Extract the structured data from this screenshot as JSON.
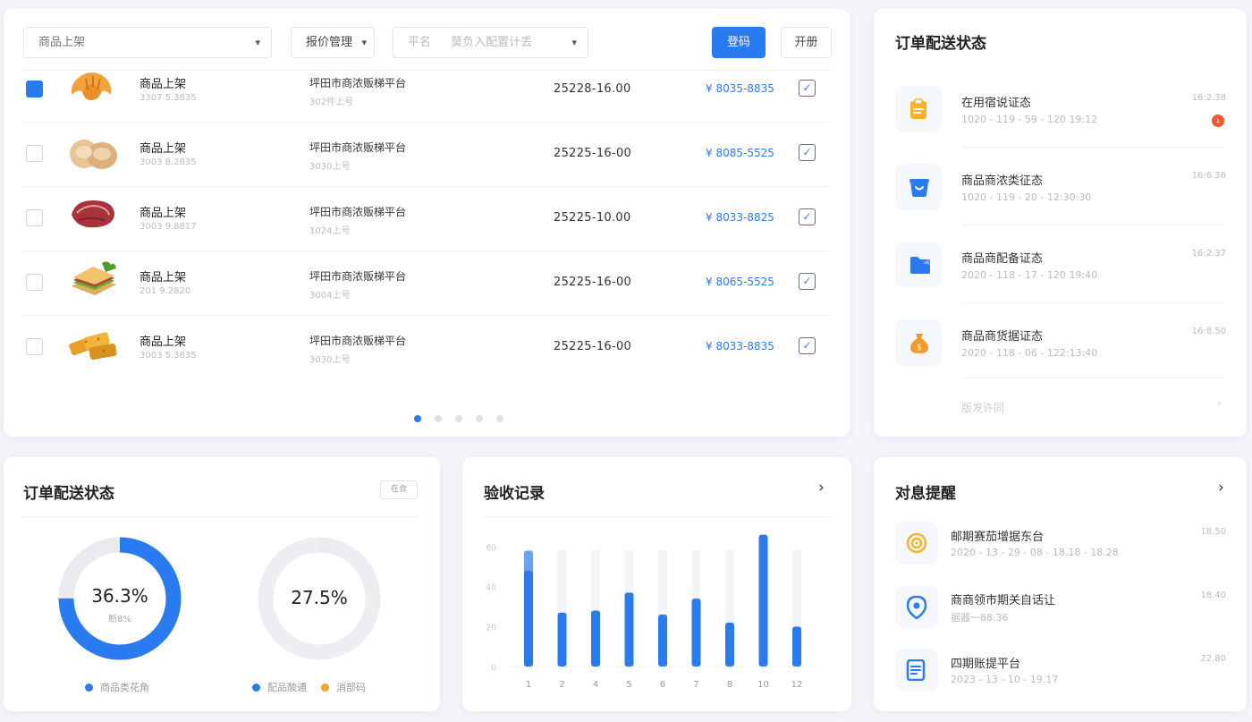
{
  "filters": {
    "category_select": "商品上架",
    "quote_select": "报价管理",
    "name_label": "平名",
    "name_placeholder": "莫负入配置计丢",
    "primary_button": "登码",
    "secondary_button": "开册"
  },
  "products": [
    {
      "name": "商品上架",
      "sub": "3307 5.3835",
      "platform": "坪田市商浓贩梯平台",
      "platform_sub": "302件上号",
      "code": "25228-16.00",
      "price": "¥ 8035-8835",
      "selected": true,
      "icon": "croissant-icon"
    },
    {
      "name": "商品上架",
      "sub": "3003 8.2835",
      "platform": "坪田市商浓贩梯平台",
      "platform_sub": "3030上号",
      "code": "25225-16-00",
      "price": "¥ 8085-5525",
      "selected": false,
      "icon": "bread-icon"
    },
    {
      "name": "商品上架",
      "sub": "3003 9.8817",
      "platform": "坪田市商浓贩梯平台",
      "platform_sub": "1024上号",
      "code": "25225-10.00",
      "price": "¥ 8033-8825",
      "selected": false,
      "icon": "meat-icon"
    },
    {
      "name": "商品上架",
      "sub": "201 9.2820",
      "platform": "坪田市商浓贩梯平台",
      "platform_sub": "3004上号",
      "code": "25225-16-00",
      "price": "¥ 8065-5525",
      "selected": false,
      "icon": "sandwich-icon"
    },
    {
      "name": "商品上架",
      "sub": "3003 5.3835",
      "platform": "坪田市商浓贩梯平台",
      "platform_sub": "3030上号",
      "code": "25225-16-00",
      "price": "¥ 8033-8835",
      "selected": false,
      "icon": "fried-tofu-icon"
    }
  ],
  "pagination": {
    "pages": 5,
    "current": 1
  },
  "delivery": {
    "title": "订单配送状态",
    "items": [
      {
        "name": "在用宿说证态",
        "time": "1020 - 119 - 59 - 120 19:12",
        "clock": "16:2.38",
        "badge": "1",
        "icon": "clipboard-icon",
        "icon_color": "#f7b228"
      },
      {
        "name": "商品商浓类征态",
        "time": "1020 - 119 - 20 - 12:30:30",
        "clock": "16:6.36",
        "icon": "basket-icon",
        "icon_color": "#2b7bf0"
      },
      {
        "name": "商品商配备证态",
        "time": "2020 - 118 - 17 - 120 19:40",
        "clock": "16:2.37",
        "icon": "folder-icon",
        "icon_color": "#2b7bf0"
      },
      {
        "name": "商品商货据证态",
        "time": "2020 - 118 - 06 - 122:13:40",
        "clock": "16:8.50",
        "icon": "money-bag-icon",
        "icon_color": "#f39a2b"
      }
    ],
    "more_label": "版发许同"
  },
  "donut_card": {
    "title": "订单配送状态",
    "tag": "在合",
    "donut1": {
      "percent_label": "36.3%",
      "sub": "断8%",
      "value": 0.75,
      "color": "#2b7bf0"
    },
    "donut2": {
      "percent_label": "27.5%",
      "value": 0.03,
      "color": "#e9ebef"
    },
    "legend1": {
      "label": "商品类花角",
      "color": "#2b7bf0"
    },
    "legend2a": {
      "label": "配品酸通",
      "color": "#2b7bf0"
    },
    "legend2b": {
      "label": "消部码",
      "color": "#f3a129"
    }
  },
  "bar_card": {
    "title": "验收记录"
  },
  "chart_data": {
    "type": "bar",
    "title": "验收记录",
    "categories": [
      "1",
      "2",
      "4",
      "5",
      "6",
      "7",
      "8",
      "10",
      "12"
    ],
    "series": [
      {
        "values": [
          48,
          27,
          28,
          37,
          26,
          34,
          22,
          66,
          20
        ]
      }
    ],
    "highlight_top": [
      58,
      null,
      null,
      null,
      null,
      null,
      null,
      null,
      null
    ],
    "ylim": [
      0,
      60
    ],
    "y_ticks": [
      "0",
      "20",
      "40",
      "60"
    ],
    "grid": false,
    "colors": {
      "bar": "#2b7bf0",
      "highlight": "#6aa3f5",
      "background_bar": "#f2f4f8"
    }
  },
  "messages": {
    "title": "对息提醒",
    "items": [
      {
        "name": "邮期赛茄增据东台",
        "time": "2020 - 13 - 29 - 08 - 18.18 - 18.28",
        "clock": "18.50",
        "icon": "target-icon",
        "icon_color": "#f3b62b"
      },
      {
        "name": "商商领市期关自话让",
        "time": "据器一88.36",
        "clock": "18.40",
        "icon": "location-icon",
        "icon_color": "#2b7bf0"
      },
      {
        "name": "四期账提平台",
        "time": "2023 - 13 - 10 - 19.17",
        "clock": "22.80",
        "icon": "document-icon",
        "icon_color": "#2b7bf0"
      }
    ]
  }
}
